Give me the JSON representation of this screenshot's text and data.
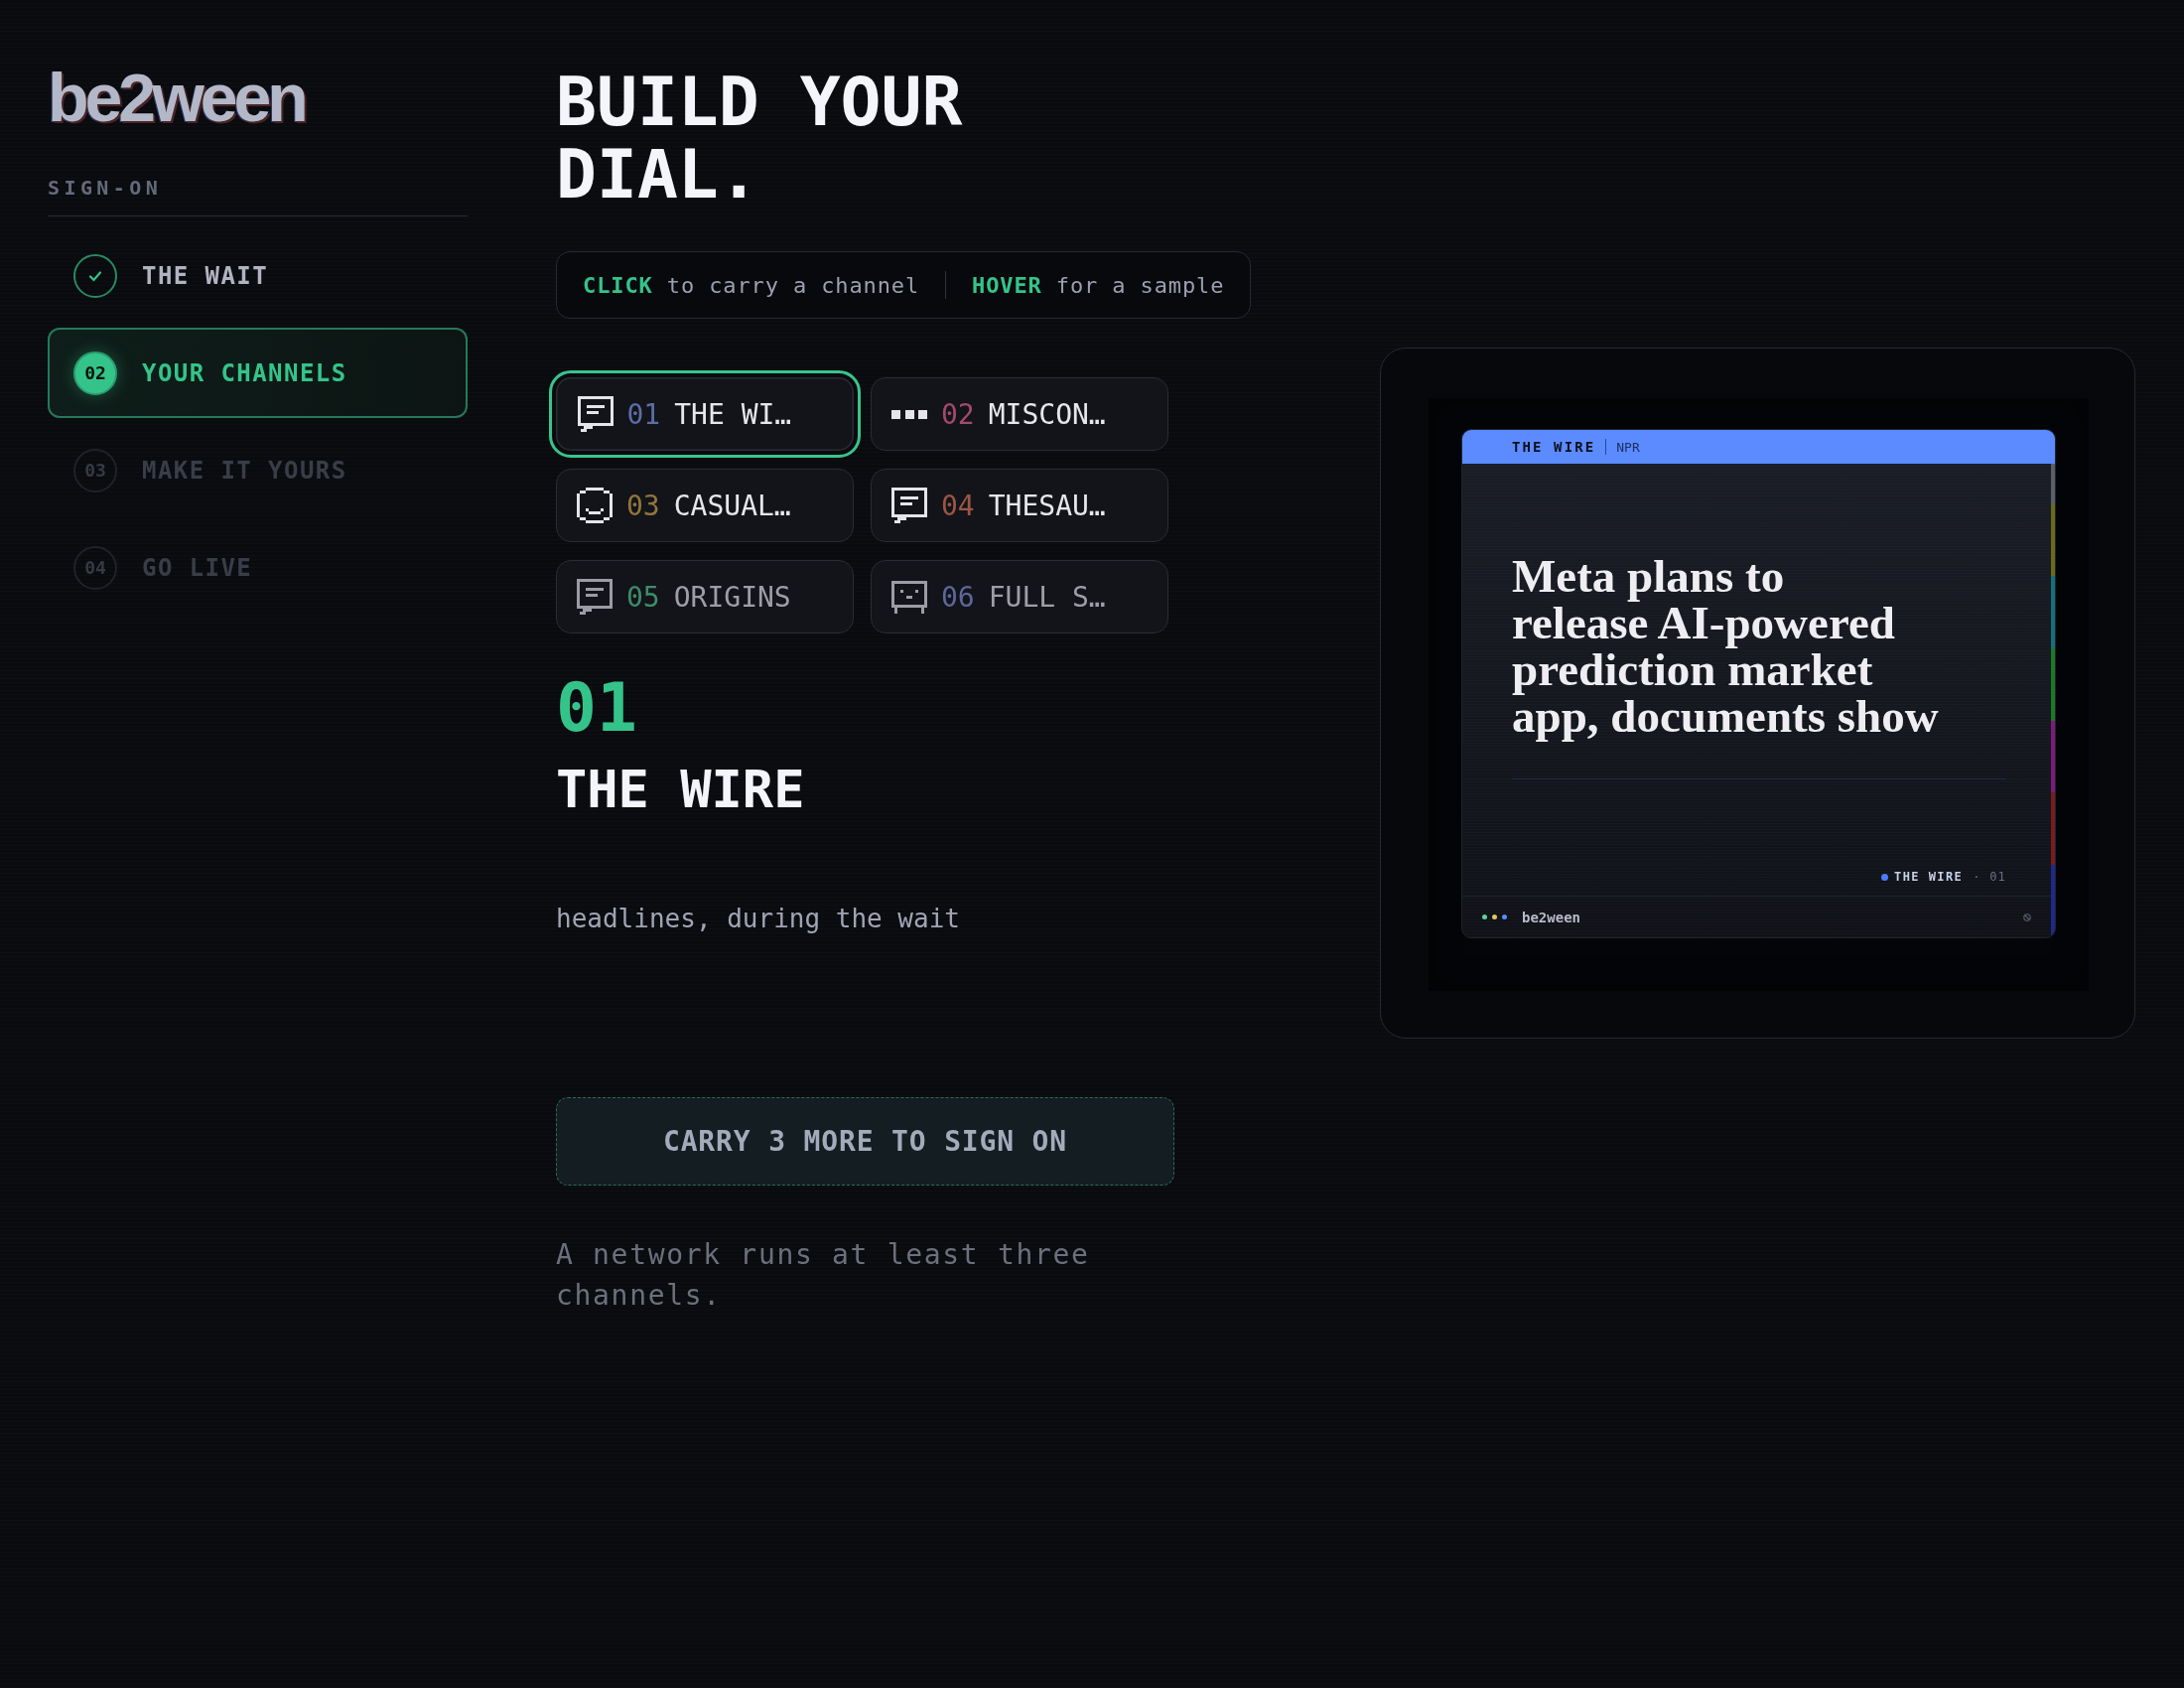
{
  "logo": "be2ween",
  "sidebar": {
    "heading": "SIGN-ON",
    "steps": [
      {
        "label": "THE WAIT",
        "completed": true,
        "selected": false,
        "disabled": false
      },
      {
        "number": "02",
        "label": "YOUR CHANNELS",
        "completed": false,
        "selected": true,
        "disabled": false
      },
      {
        "number": "03",
        "label": "MAKE IT YOURS",
        "completed": false,
        "selected": false,
        "disabled": true
      },
      {
        "number": "04",
        "label": "GO LIVE",
        "completed": false,
        "selected": false,
        "disabled": true
      }
    ]
  },
  "title": "BUILD YOUR DIAL.",
  "hints": [
    "**CLICK** to carry a channel",
    "**HOVER** for a sample"
  ],
  "channels": [
    {
      "kind": "bubble",
      "number": "01",
      "label": "THE WI…",
      "color": "#5a6fa8",
      "selected": true,
      "faded": false
    },
    {
      "kind": "dots",
      "number": "02",
      "label": "MISCON…",
      "color": "#a04a6c",
      "selected": false,
      "faded": false
    },
    {
      "kind": "face",
      "number": "03",
      "label": "CASUAL…",
      "color": "#93753c",
      "selected": false,
      "faded": false
    },
    {
      "kind": "bubble",
      "number": "04",
      "label": "THESAU…",
      "color": "#9a5646",
      "selected": false,
      "faded": false
    },
    {
      "kind": "bubble",
      "number": "05",
      "label": "ORIGINS",
      "color": "#3f8c68",
      "selected": false,
      "faded": true
    },
    {
      "kind": "screen",
      "number": "06",
      "label": "FULL S…",
      "color": "#5c679c",
      "selected": false,
      "faded": true
    }
  ],
  "detail": {
    "number": "01",
    "name": "THE WIRE",
    "description": "headlines, during the wait"
  },
  "action_button": {
    "label": "CARRY 3 MORE TO SIGN ON",
    "disabled": true
  },
  "note": "A network runs at least three channels.",
  "preview": {
    "channel": "THE WIRE",
    "source": "NPR",
    "headline": "Meta plans to\nrelease AI-powered\nprediction market\napp, documents show",
    "tag": "THE WIRE",
    "tag_number": "· 01",
    "brand": "be2ween"
  }
}
